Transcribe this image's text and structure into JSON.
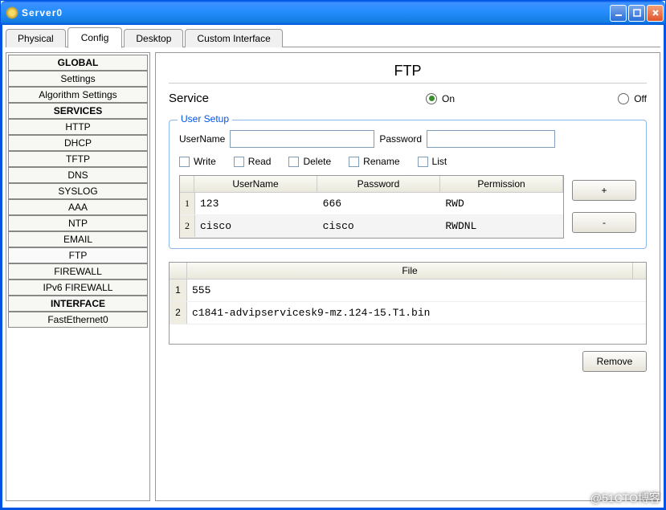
{
  "window": {
    "title": "Server0"
  },
  "tabs": [
    "Physical",
    "Config",
    "Desktop",
    "Custom Interface"
  ],
  "active_tab": "Config",
  "sidebar": {
    "sections": [
      {
        "header": "GLOBAL",
        "items": [
          "Settings",
          "Algorithm Settings"
        ]
      },
      {
        "header": "SERVICES",
        "items": [
          "HTTP",
          "DHCP",
          "TFTP",
          "DNS",
          "SYSLOG",
          "AAA",
          "NTP",
          "EMAIL",
          "FTP",
          "FIREWALL",
          "IPv6 FIREWALL"
        ]
      },
      {
        "header": "INTERFACE",
        "items": [
          "FastEthernet0"
        ]
      }
    ]
  },
  "panel": {
    "title": "FTP",
    "service_label": "Service",
    "on_label": "On",
    "off_label": "Off",
    "service_on": true,
    "user_setup": {
      "legend": "User Setup",
      "username_label": "UserName",
      "password_label": "Password",
      "username_value": "",
      "password_value": "",
      "perms": {
        "write": "Write",
        "read": "Read",
        "delete": "Delete",
        "rename": "Rename",
        "list": "List"
      },
      "table": {
        "headers": [
          "UserName",
          "Password",
          "Permission"
        ],
        "rows": [
          {
            "n": "1",
            "user": "123",
            "pass": "666",
            "perm": "RWD"
          },
          {
            "n": "2",
            "user": "cisco",
            "pass": "cisco",
            "perm": "RWDNL"
          }
        ]
      },
      "add_btn": "+",
      "del_btn": "-"
    },
    "files": {
      "header": "File",
      "rows": [
        {
          "n": "1",
          "name": "555"
        },
        {
          "n": "2",
          "name": "c1841-advipservicesk9-mz.124-15.T1.bin"
        }
      ]
    },
    "remove_btn": "Remove"
  },
  "watermark": "@51CTO博客"
}
